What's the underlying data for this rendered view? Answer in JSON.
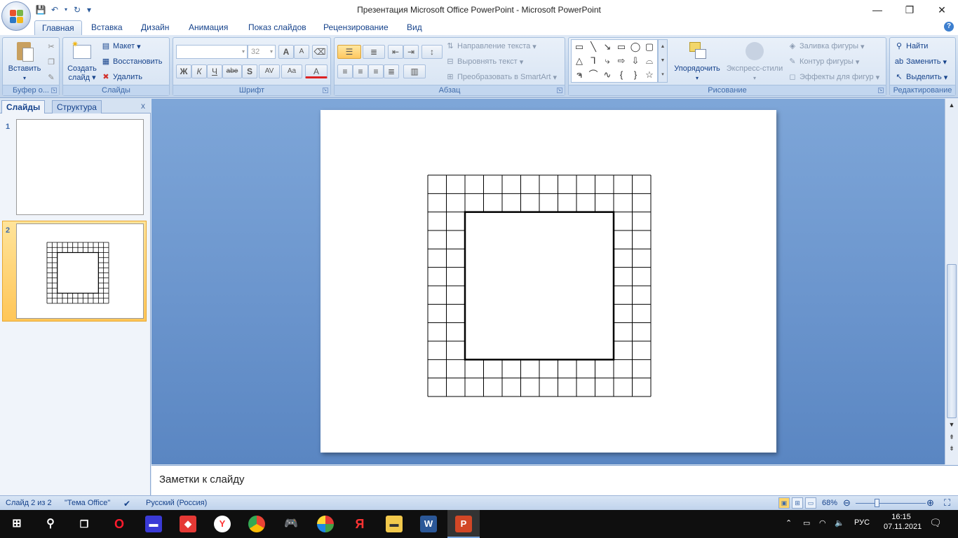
{
  "window": {
    "title": "Презентация Microsoft Office PowerPoint - Microsoft PowerPoint",
    "controls": {
      "minimize": "—",
      "restore": "❐",
      "close": "✕"
    }
  },
  "quick_access": {
    "save_icon": "save-icon",
    "undo_icon": "undo-icon",
    "repeat_icon": "repeat-icon",
    "customize": "▾"
  },
  "tabs": [
    "Главная",
    "Вставка",
    "Дизайн",
    "Анимация",
    "Показ слайдов",
    "Рецензирование",
    "Вид"
  ],
  "active_tab": "Главная",
  "help": "?",
  "ribbon": {
    "clipboard": {
      "label": "Буфер о...",
      "paste": "Вставить"
    },
    "slides": {
      "label": "Слайды",
      "create": "Создать",
      "create2": "слайд",
      "layout": "Макет",
      "reset": "Восстановить",
      "delete": "Удалить"
    },
    "font": {
      "label": "Шрифт",
      "size": "32",
      "bold": "Ж",
      "italic": "К",
      "underline": "Ч",
      "strike": "abe",
      "shadow": "S",
      "spacing": "AV",
      "case": "Aa",
      "color": "A",
      "grow": "A",
      "shrink": "A"
    },
    "paragraph": {
      "label": "Абзац",
      "text_direction": "Направление текста",
      "align_text": "Выровнять текст",
      "smartart": "Преобразовать в SmartArt"
    },
    "drawing": {
      "label": "Рисование",
      "arrange": "Упорядочить",
      "quick_styles": "Экспресс-стили",
      "fill": "Заливка фигуры",
      "outline": "Контур фигуры",
      "effects": "Эффекты для фигур"
    },
    "editing": {
      "label": "Редактирование",
      "find": "Найти",
      "replace": "Заменить",
      "select": "Выделить"
    }
  },
  "panel": {
    "tab_slides": "Слайды",
    "tab_outline": "Структура",
    "close": "x",
    "slides": [
      {
        "number": "1"
      },
      {
        "number": "2"
      }
    ],
    "selected_slide": 2
  },
  "slide_content": {
    "grid_columns": 12,
    "grid_rows": 12,
    "inner_square_from": 2,
    "inner_square_to": 10
  },
  "notes": {
    "placeholder": "Заметки к слайду"
  },
  "statusbar": {
    "slide_info": "Слайд 2 из 2",
    "theme": "\"Тема Office\"",
    "language": "Русский (Россия)",
    "zoom": "68%"
  },
  "taskbar": {
    "apps": [
      "windows-start-icon",
      "search-icon",
      "task-view-icon",
      "opera-icon",
      "save-app-icon",
      "anydesk-icon",
      "yandex-browser-icon",
      "chrome-icon",
      "games-icon",
      "globe-icon",
      "yandex-icon",
      "explorer-icon",
      "word-icon",
      "powerpoint-icon"
    ],
    "lang": "РУС",
    "time": "16:15",
    "date": "07.11.2021"
  }
}
